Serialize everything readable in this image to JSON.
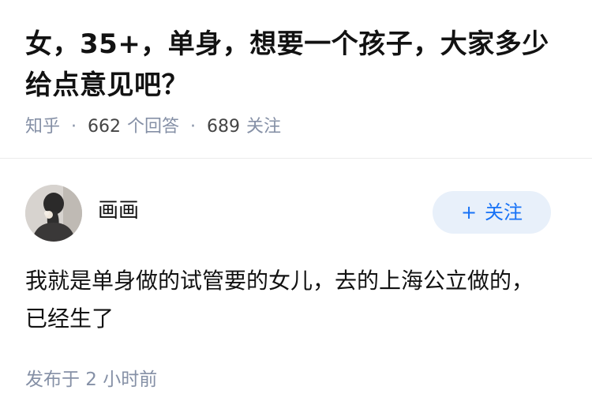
{
  "question": {
    "title": "女，35+，单身，想要一个孩子，大家多少给点意见吧？",
    "source": "知乎",
    "separator": "·",
    "answer_count": "662",
    "answer_label": "个回答",
    "follower_count": "689",
    "follower_label": "关注"
  },
  "author": {
    "name": "画画",
    "follow_plus": "+",
    "follow_label": "关注"
  },
  "answer": {
    "content": "我就是单身做的试管要的女儿，去的上海公立做的，已经生了",
    "time": "发布于 2 小时前"
  },
  "colors": {
    "title": "#121212",
    "meta": "#8590a6",
    "follow_bg": "#e8f0fa",
    "follow_text": "#1772f6"
  },
  "icons": {
    "avatar": "person-avatar"
  }
}
